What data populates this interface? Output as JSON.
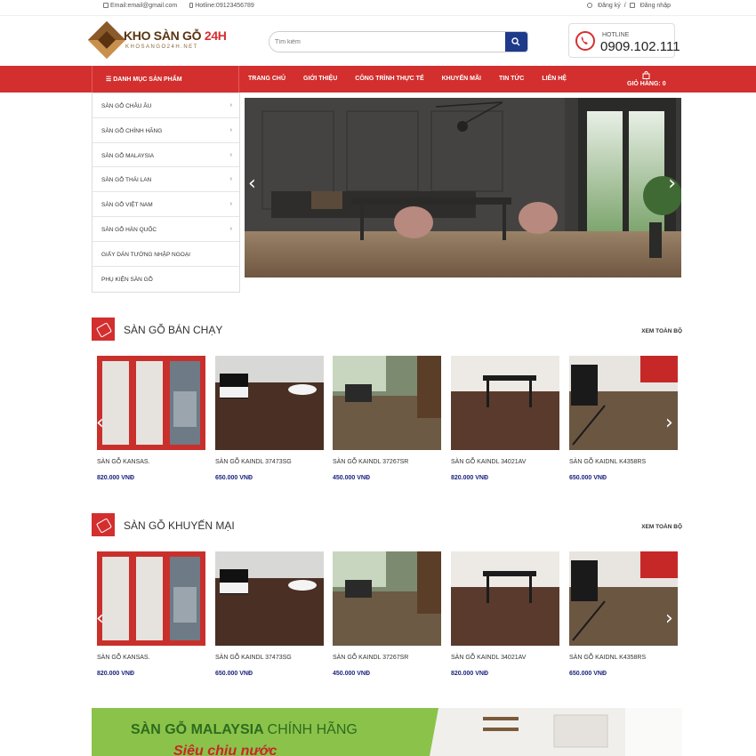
{
  "topbar": {
    "email": "Email:email@gmail.com",
    "hotline": "Hotline:09123456789",
    "register": "Đăng ký",
    "sep": "/",
    "login": "Đăng nhập"
  },
  "header": {
    "logo_main": "KHO SÀN GỖ",
    "logo_accent": "24H",
    "logo_sub": "KHOSANGO24H.NET",
    "search_placeholder": "Tìm kiếm",
    "hotline_label": "HOTLINE",
    "hotline_number": "0909.102.111"
  },
  "nav": {
    "category_label": "Danh mục sản phẩm",
    "items": [
      "TRANG CHỦ",
      "GIỚI THIỆU",
      "CÔNG TRÌNH THỰC TẾ",
      "KHUYẾN MÃI",
      "TIN TỨC",
      "LIÊN HỆ"
    ],
    "cart_label": "GIỎ HÀNG:",
    "cart_count": "0"
  },
  "sidebar": {
    "items": [
      {
        "label": "Sàn gỗ Châu Âu",
        "chev": "›"
      },
      {
        "label": "Sàn gỗ chính hãng",
        "chev": "›"
      },
      {
        "label": "Sàn gỗ Malaysia",
        "chev": "›"
      },
      {
        "label": "Sàn gỗ Thái Lan",
        "chev": "›"
      },
      {
        "label": "Sàn gỗ Việt Nam",
        "chev": "›"
      },
      {
        "label": "Sàn gỗ Hàn Quốc",
        "chev": "›"
      },
      {
        "label": "Giấy dán tường nhập ngoại",
        "chev": ""
      },
      {
        "label": "Phụ kiện sàn gỗ",
        "chev": ""
      }
    ]
  },
  "sections": [
    {
      "title": "SÀN GỖ BÁN CHẠY",
      "more": "XEM TOÀN BỘ",
      "products": [
        {
          "name": "SÀN GỖ KANSAS.",
          "price": "820.000 VNĐ"
        },
        {
          "name": "SÀN GỖ KAINDL 37473SG",
          "price": "650.000 VNĐ"
        },
        {
          "name": "SÀN GỖ KAINDL 37267SR",
          "price": "450.000 VNĐ"
        },
        {
          "name": "SÀN GỖ KAINDL 34021AV",
          "price": "820.000 VNĐ"
        },
        {
          "name": "SÀN GỖ KAIDNL K4358RS",
          "price": "650.000 VNĐ"
        }
      ]
    },
    {
      "title": "SÀN GỖ KHUYẾN MẠI",
      "more": "XEM TOÀN BỘ",
      "products": [
        {
          "name": "SÀN GỖ KANSAS.",
          "price": "820.000 VNĐ"
        },
        {
          "name": "SÀN GỖ KAINDL 37473SG",
          "price": "650.000 VNĐ"
        },
        {
          "name": "SÀN GỖ KAINDL 37267SR",
          "price": "450.000 VNĐ"
        },
        {
          "name": "SÀN GỖ KAINDL 34021AV",
          "price": "820.000 VNĐ"
        },
        {
          "name": "SÀN GỖ KAIDNL K4358RS",
          "price": "650.000 VNĐ"
        }
      ]
    }
  ],
  "promo": {
    "line1a": "SÀN GỖ MALAYSIA",
    "line1b": "CHÍNH HÃNG",
    "line2": "Siêu chịu nước"
  },
  "colors": {
    "brand_red": "#d32f2f",
    "search_blue": "#1e3a8a",
    "price_blue": "#1a237e"
  },
  "icons": {
    "prev": "‹",
    "next": "›"
  }
}
